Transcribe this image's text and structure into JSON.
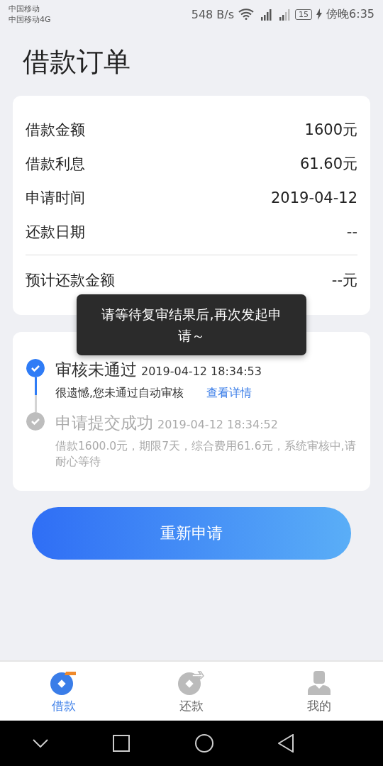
{
  "status_bar": {
    "carriers": [
      "中国移动",
      "中国移动4G"
    ],
    "speed": "548 B/s",
    "battery": "15",
    "time": "傍晚6:35"
  },
  "title": "借款订单",
  "summary": {
    "rows": [
      {
        "label": "借款金额",
        "value": "1600元"
      },
      {
        "label": "借款利息",
        "value": "61.60元"
      },
      {
        "label": "申请时间",
        "value": "2019-04-12"
      },
      {
        "label": "还款日期",
        "value": "--"
      }
    ],
    "total": {
      "label": "预计还款金额",
      "value": "--元"
    }
  },
  "timeline": [
    {
      "title": "审核未通过",
      "time": "2019-04-12 18:34:53",
      "desc": "很遗憾,您未通过自动审核",
      "link": "查看详情",
      "active": true
    },
    {
      "title": "申请提交成功",
      "time": "2019-04-12 18:34:52",
      "desc": "借款1600.0元，期限7天，综合费用61.6元，系统审核中,请耐心等待",
      "active": false
    }
  ],
  "button": "重新申请",
  "toast": "请等待复审结果后,再次发起申请～",
  "tabs": [
    {
      "label": "借款",
      "selected": true
    },
    {
      "label": "还款",
      "selected": false
    },
    {
      "label": "我的",
      "selected": false
    }
  ]
}
